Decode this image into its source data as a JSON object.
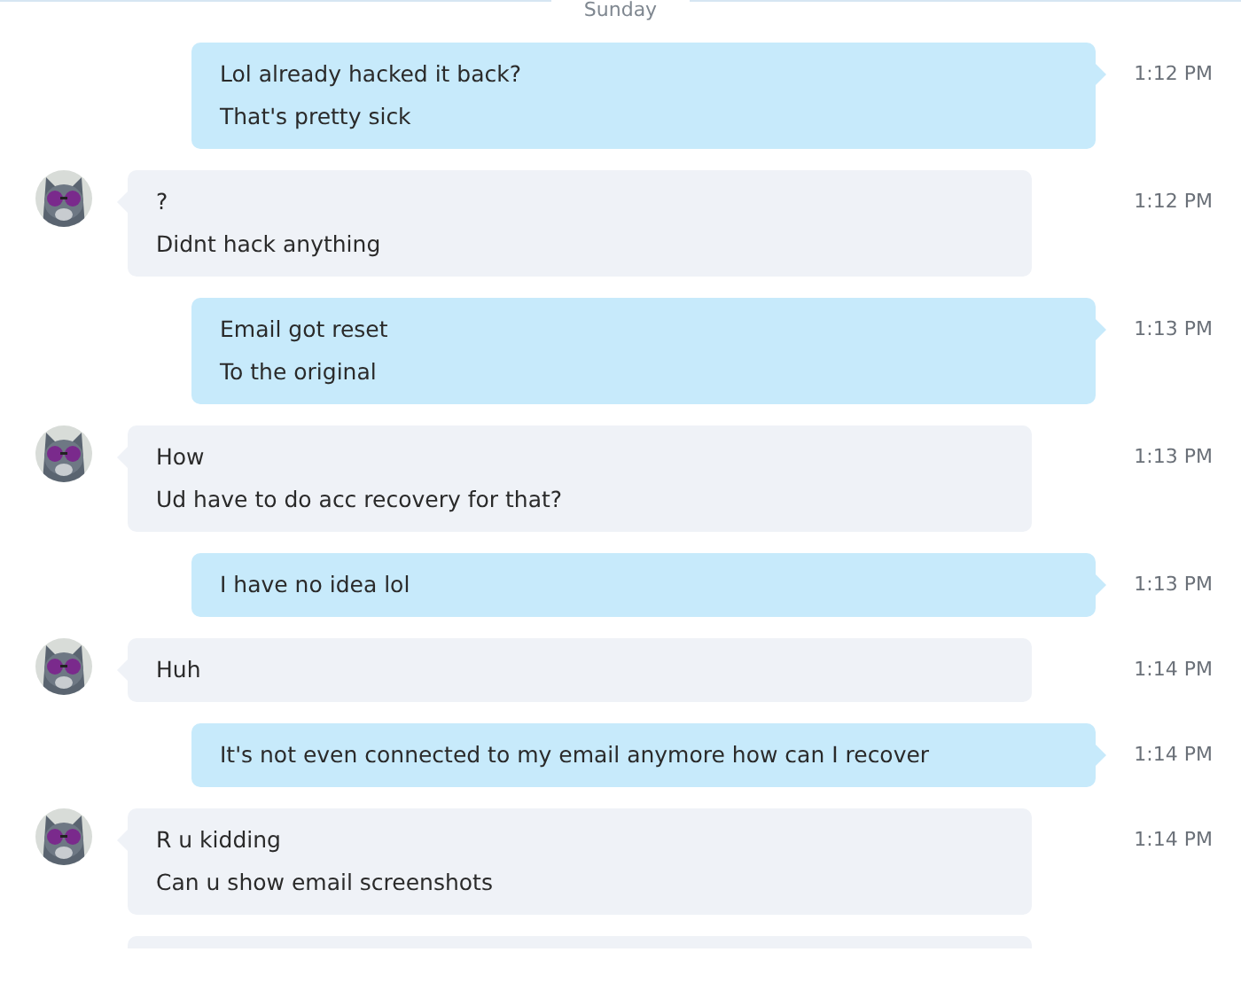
{
  "date_divider": "Sunday",
  "messages": [
    {
      "kind": "outgoing",
      "lines": [
        "Lol already hacked it back?",
        "That's pretty sick"
      ],
      "time": "1:12 PM"
    },
    {
      "kind": "incoming",
      "lines": [
        "?",
        "Didnt hack anything"
      ],
      "time": "1:12 PM"
    },
    {
      "kind": "outgoing",
      "lines": [
        "Email got reset",
        "To the original"
      ],
      "time": "1:13 PM"
    },
    {
      "kind": "incoming",
      "lines": [
        "How",
        "Ud have to do acc recovery for that?"
      ],
      "time": "1:13 PM"
    },
    {
      "kind": "outgoing",
      "lines": [
        "I have no idea lol"
      ],
      "time": "1:13 PM"
    },
    {
      "kind": "incoming",
      "lines": [
        "Huh"
      ],
      "time": "1:14 PM"
    },
    {
      "kind": "outgoing",
      "lines": [
        "It's not even connected to my email anymore how can I recover"
      ],
      "time": "1:14 PM"
    },
    {
      "kind": "incoming",
      "lines": [
        "R u kidding",
        "Can u show email screenshots"
      ],
      "time": "1:14 PM"
    },
    {
      "kind": "incoming_cut"
    }
  ]
}
